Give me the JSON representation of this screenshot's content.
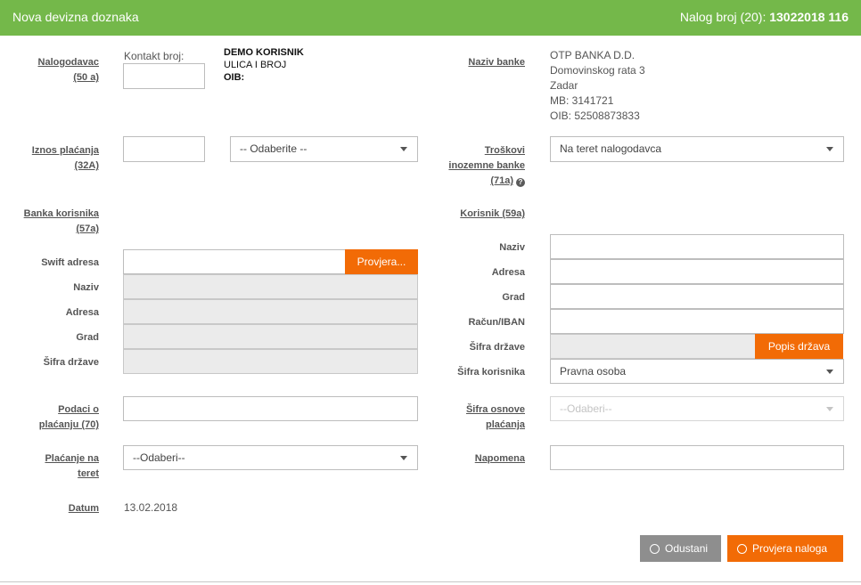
{
  "header": {
    "title": "Nova devizna doznaka",
    "order_label": "Nalog broj (20):",
    "order_number": "13022018 116"
  },
  "nalogodavac": {
    "label_line1": "Nalogodavac",
    "label_line2": "(50 a)",
    "contact_label": "Kontakt broj:",
    "contact_value": "",
    "name": "DEMO KORISNIK",
    "address": "ULICA I BROJ",
    "oib_label": "OIB:"
  },
  "naziv_banke": {
    "label": "Naziv banke",
    "lines": [
      "OTP BANKA D.D.",
      "Domovinskog rata 3",
      "Zadar",
      "MB: 3141721",
      "OIB: 52508873833"
    ]
  },
  "iznos": {
    "label_line1": "Iznos plaćanja",
    "label_line2": "(32A)",
    "amount_value": "",
    "currency_selected": "-- Odaberite --"
  },
  "troskovi": {
    "label_line1": "Troškovi",
    "label_line2": "inozemne banke",
    "label_line3": "(71a)",
    "help_icon": "question-circle-icon",
    "selected": "Na teret nalogodavca"
  },
  "banka_korisnika": {
    "label_line1": "Banka korisnika",
    "label_line2": "(57a)",
    "swift_label": "Swift adresa",
    "swift_value": "",
    "check_button": "Provjera...",
    "naziv_label": "Naziv",
    "adresa_label": "Adresa",
    "grad_label": "Grad",
    "sifra_drzave_label": "Šifra države"
  },
  "korisnik": {
    "label": "Korisnik (59a)",
    "naziv_label": "Naziv",
    "adresa_label": "Adresa",
    "grad_label": "Grad",
    "racun_label": "Račun/IBAN",
    "sifra_drzave_label": "Šifra države",
    "popis_button": "Popis država",
    "sifra_korisnika_label": "Šifra korisnika",
    "sifra_korisnika_selected": "Pravna osoba"
  },
  "podaci": {
    "label_line1": "Podaci o",
    "label_line2": "plaćanju (70)",
    "value": ""
  },
  "sifra_osnove": {
    "label_line1": "Šifra osnove",
    "label_line2": "plaćanja",
    "selected": "--Odaberi--"
  },
  "placanje_na_teret": {
    "label_line1": "Plaćanje na",
    "label_line2": "teret",
    "selected": "--Odaberi--"
  },
  "napomena": {
    "label": "Napomena",
    "value": ""
  },
  "datum": {
    "label": "Datum",
    "value": "13.02.2018"
  },
  "actions": {
    "cancel_label": "Odustani",
    "cancel_icon": "times-circle-icon",
    "check_label": "Provjera naloga",
    "check_icon": "check-circle-icon"
  },
  "colors": {
    "header": "#74b84a",
    "accent": "#f26b06",
    "cancel": "#8e8e8e"
  }
}
